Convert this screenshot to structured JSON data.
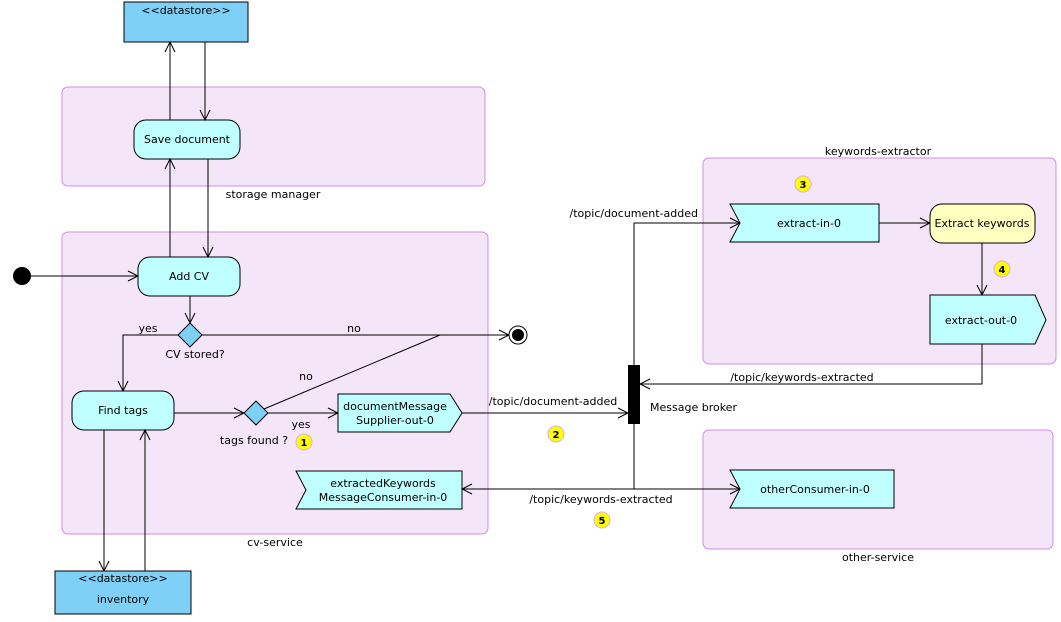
{
  "colors": {
    "activity": "#c0ffff",
    "datastore": "#7fd0f7",
    "partition": "#f4e6f8",
    "partition_border": "#cf8ee8",
    "highlight_activity": "#ffffc0",
    "badge": "#ffff00",
    "decision": "#7ecff4"
  },
  "datastore_top": {
    "stereotype": "<<datastore>>"
  },
  "datastore_bottom": {
    "stereotype": "<<datastore>>",
    "name": "inventory"
  },
  "partitions": {
    "storage_manager": "storage manager",
    "cv_service": "cv-service",
    "keywords_extractor": "keywords-extractor",
    "other_service": "other-service"
  },
  "activities": {
    "save_document": "Save document",
    "add_cv": "Add CV",
    "find_tags": "Find tags",
    "extract_keywords": "Extract keywords"
  },
  "decisions": {
    "cv_stored": "CV stored?",
    "cv_yes": "yes",
    "cv_no": "no",
    "tags_found": "tags found ?",
    "tags_yes": "yes",
    "tags_no": "no"
  },
  "signals": {
    "doc_out_line1": "documentMessage",
    "doc_out_line2": "Supplier-out-0",
    "kw_in_line1": "extractedKeywords",
    "kw_in_line2": "MessageConsumer-in-0",
    "extract_in": "extract-in-0",
    "extract_out": "extract-out-0",
    "other_in": "otherConsumer-in-0"
  },
  "broker": {
    "label": "Message broker"
  },
  "topics": {
    "doc_added_in": "/topic/document-added",
    "doc_added_out": "/topic/document-added",
    "kw_extracted_in": "/topic/keywords-extracted",
    "kw_extracted_out": "/topic/keywords-extracted"
  },
  "badges": [
    "1",
    "2",
    "3",
    "4",
    "5"
  ]
}
